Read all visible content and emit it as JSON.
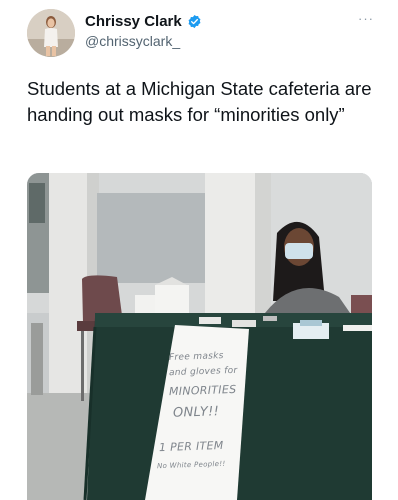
{
  "author": {
    "display_name": "Chrissy Clark",
    "handle": "@chrissyclark_",
    "verified": true,
    "avatar_icon": "profile-photo",
    "verified_icon": "verified-badge-icon",
    "verified_color": "#1d9bf0"
  },
  "menu": {
    "more_label": "···",
    "more_icon": "more-options-icon"
  },
  "tweet": {
    "text": "Students at a Michigan State cafeteria are handing out masks for “minorities only”"
  },
  "media": {
    "sign": {
      "line1": "Free masks",
      "line2": "and gloves for",
      "line3": "MINORITIES",
      "line4": "ONLY!!",
      "line5": "1 PER ITEM",
      "line6": "No White People!!"
    }
  }
}
